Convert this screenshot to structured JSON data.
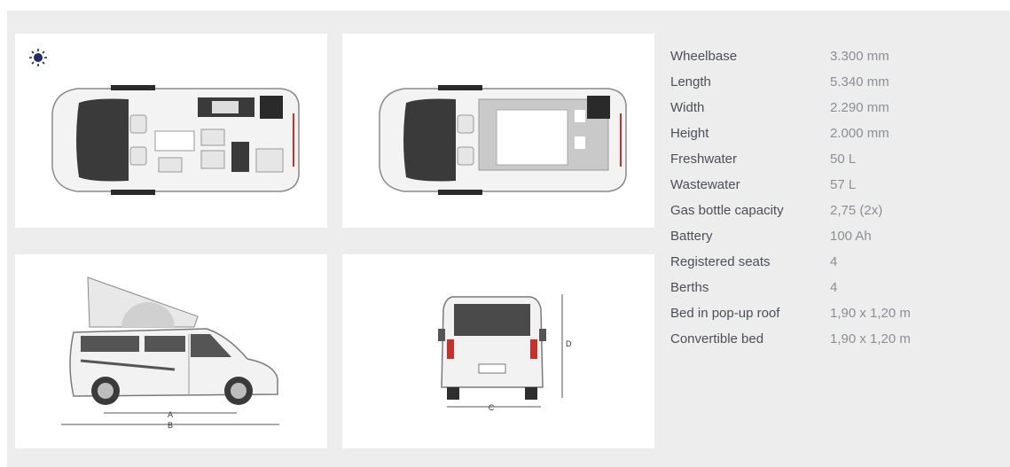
{
  "layout_views": {
    "day_icon": "sun-icon",
    "night_icon": "moon-icon"
  },
  "dimension_marks": {
    "a": "A",
    "b": "B",
    "c": "C",
    "d": "D"
  },
  "specs": [
    {
      "label": "Wheelbase",
      "value": "3.300 mm"
    },
    {
      "label": "Length",
      "value": "5.340 mm"
    },
    {
      "label": "Width",
      "value": "2.290 mm"
    },
    {
      "label": "Height",
      "value": "2.000 mm"
    },
    {
      "label": "Freshwater",
      "value": "50 L"
    },
    {
      "label": "Wastewater",
      "value": "57 L"
    },
    {
      "label": "Gas bottle capacity",
      "value": "2,75 (2x)"
    },
    {
      "label": "Battery",
      "value": "100 Ah"
    },
    {
      "label": "Registered seats",
      "value": "4"
    },
    {
      "label": "Berths",
      "value": "4"
    },
    {
      "label": "Bed in pop-up roof",
      "value": "1,90 x 1,20 m"
    },
    {
      "label": "Convertible bed",
      "value": "1,90 x 1,20 m"
    }
  ],
  "colors": {
    "panel_bg": "#ededed",
    "icon_blue": "#1f2d6b",
    "label_text": "#4a4f5a",
    "value_text": "#8a8f96"
  }
}
